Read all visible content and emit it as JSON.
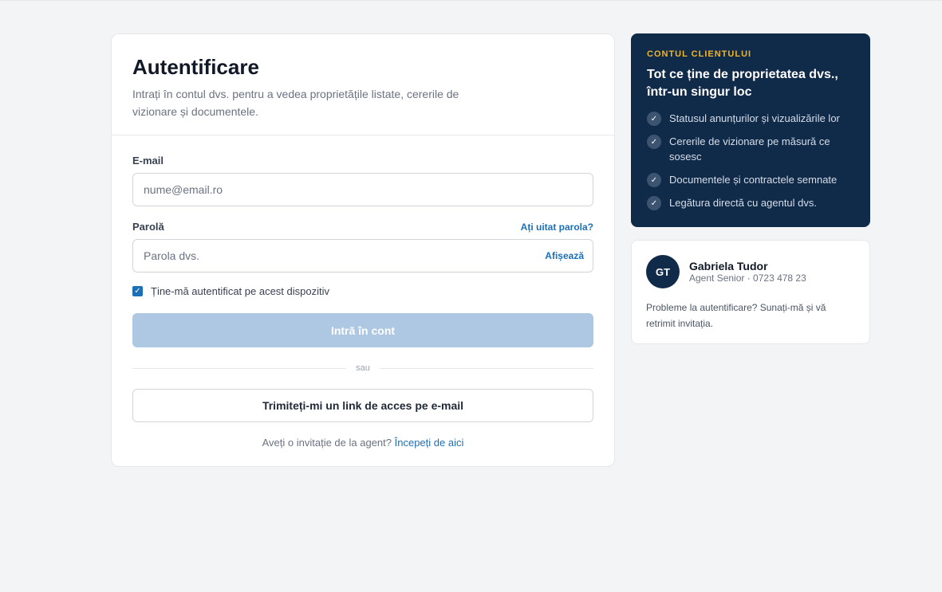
{
  "login": {
    "title": "Autentificare",
    "subtitle": "Intrați în contul dvs. pentru a vedea proprietățile listate, cererile de vizionare și documentele.",
    "email_label": "E-mail",
    "email_placeholder": "nume@email.ro",
    "password_label": "Parolă",
    "forgot_password": "Ați uitat parola?",
    "password_placeholder": "Parola dvs.",
    "show_password": "Afișează",
    "remember_label": "Ține-mă autentificat pe acest dispozitiv",
    "remember_checked": true,
    "submit_label": "Intră în cont",
    "divider_text": "sau",
    "magic_link_label": "Trimiteți-mi un link de acces pe e-mail",
    "invite_prompt": "Aveți o invitație de la agent?",
    "invite_link": "Începeți de aici"
  },
  "features": {
    "eyebrow": "CONTUL CLIENTULUI",
    "title": "Tot ce ține de proprietatea dvs., într-un singur loc",
    "items": [
      "Statusul anunțurilor și vizualizările lor",
      "Cererile de vizionare pe măsură ce sosesc",
      "Documentele și contractele semnate",
      "Legătura directă cu agentul dvs."
    ]
  },
  "agent": {
    "initials": "GT",
    "name": "Gabriela Tudor",
    "meta": "Agent Senior · 0723 478 23",
    "note": "Probleme la autentificare? Sunați-mă și vă retrimit invitația."
  },
  "colors": {
    "accent": "#1d6fb8",
    "panel": "#102a4a",
    "eyebrow": "#f0b429",
    "button_disabled": "#aec8e4"
  }
}
